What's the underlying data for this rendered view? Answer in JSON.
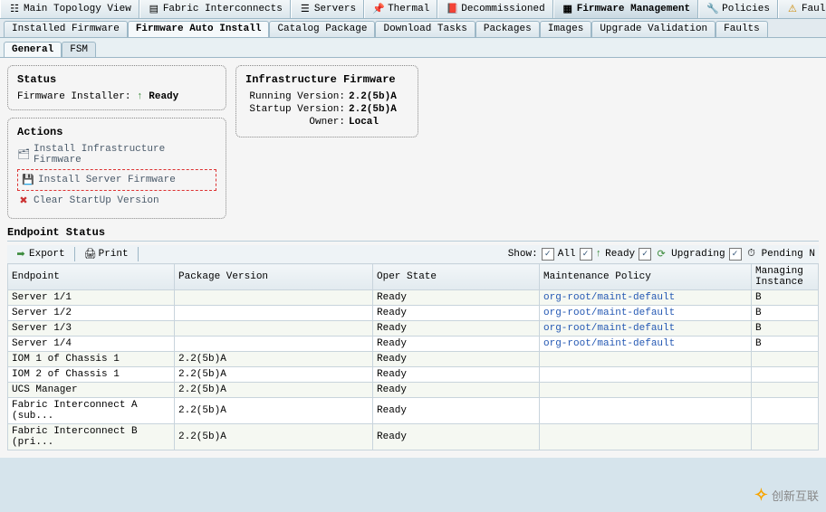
{
  "topTabs": [
    {
      "label": "Main Topology View"
    },
    {
      "label": "Fabric Interconnects"
    },
    {
      "label": "Servers"
    },
    {
      "label": "Thermal"
    },
    {
      "label": "Decommissioned"
    },
    {
      "label": "Firmware Management"
    },
    {
      "label": "Policies"
    },
    {
      "label": "Faults"
    }
  ],
  "subTabs": [
    {
      "label": "Installed Firmware"
    },
    {
      "label": "Firmware Auto Install"
    },
    {
      "label": "Catalog Package"
    },
    {
      "label": "Download Tasks"
    },
    {
      "label": "Packages"
    },
    {
      "label": "Images"
    },
    {
      "label": "Upgrade Validation"
    },
    {
      "label": "Faults"
    }
  ],
  "innerTabs": {
    "general": "General",
    "fsm": "FSM"
  },
  "status": {
    "title": "Status",
    "installerLabel": "Firmware Installer:",
    "installerState": "Ready"
  },
  "actions": {
    "title": "Actions",
    "installInfra": "Install Infrastructure Firmware",
    "installServer": "Install Server Firmware",
    "clearStartup": "Clear StartUp Version"
  },
  "infra": {
    "title": "Infrastructure Firmware",
    "runningLabel": "Running Version:",
    "runningValue": "2.2(5b)A",
    "startupLabel": "Startup Version:",
    "startupValue": "2.2(5b)A",
    "ownerLabel": "Owner:",
    "ownerValue": "Local"
  },
  "endpointHead": "Endpoint Status",
  "toolbar": {
    "export": "Export",
    "print": "Print",
    "showLabel": "Show:",
    "all": "All",
    "ready": "Ready",
    "upgrading": "Upgrading",
    "pending": "Pending N"
  },
  "columns": {
    "endpoint": "Endpoint",
    "package": "Package Version",
    "oper": "Oper State",
    "maint": "Maintenance Policy",
    "managing": "Managing Instance"
  },
  "rows": [
    {
      "endpoint": "Server 1/1",
      "package": "",
      "oper": "Ready",
      "maint": "org-root/maint-default",
      "managing": "B"
    },
    {
      "endpoint": "Server 1/2",
      "package": "",
      "oper": "Ready",
      "maint": "org-root/maint-default",
      "managing": "B"
    },
    {
      "endpoint": "Server 1/3",
      "package": "",
      "oper": "Ready",
      "maint": "org-root/maint-default",
      "managing": "B"
    },
    {
      "endpoint": "Server 1/4",
      "package": "",
      "oper": "Ready",
      "maint": "org-root/maint-default",
      "managing": "B"
    },
    {
      "endpoint": "IOM 1 of Chassis 1",
      "package": "2.2(5b)A",
      "oper": "Ready",
      "maint": "",
      "managing": ""
    },
    {
      "endpoint": "IOM 2 of Chassis 1",
      "package": "2.2(5b)A",
      "oper": "Ready",
      "maint": "",
      "managing": ""
    },
    {
      "endpoint": "UCS Manager",
      "package": "2.2(5b)A",
      "oper": "Ready",
      "maint": "",
      "managing": ""
    },
    {
      "endpoint": "Fabric Interconnect A (sub...",
      "package": "2.2(5b)A",
      "oper": "Ready",
      "maint": "",
      "managing": ""
    },
    {
      "endpoint": "Fabric Interconnect B (pri...",
      "package": "2.2(5b)A",
      "oper": "Ready",
      "maint": "",
      "managing": ""
    }
  ],
  "watermark": "创新互联"
}
